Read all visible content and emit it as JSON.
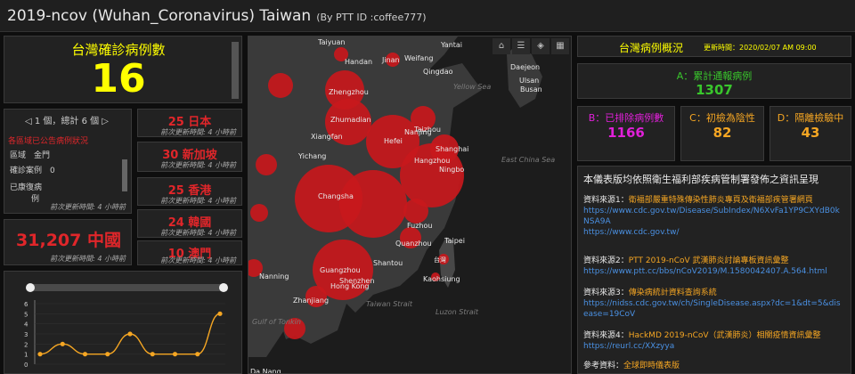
{
  "header": {
    "title": "2019-ncov (Wuhan_Coronavirus) Taiwan",
    "byline": "(By PTT ID :coffee777)"
  },
  "total": {
    "label": "台灣確診病例數",
    "value": "16"
  },
  "regions": {
    "pager": "1 個，總計 6 個",
    "heading": "各區域已公告病例狀況",
    "rows": [
      {
        "k": "區域",
        "v": "金門"
      },
      {
        "k": "確診案例",
        "v": "0"
      },
      {
        "k": "已康復病",
        "v": ""
      },
      {
        "k": "例",
        "v": ""
      }
    ],
    "updated": "前次更新時間: 4 小時前"
  },
  "china": {
    "value": "31,207 中國",
    "updated": "前次更新時間: 4 小時前"
  },
  "countries": [
    {
      "value": "25 日本",
      "updated": "前次更新時間: 4 小時前"
    },
    {
      "value": "30 新加坡",
      "updated": "前次更新時間: 4 小時前"
    },
    {
      "value": "25 香港",
      "updated": "前次更新時間: 4 小時前"
    },
    {
      "value": "24 韓國",
      "updated": "前次更新時間: 4 小時前"
    },
    {
      "value": "10 澳門",
      "updated": "前次更新時間: 4 小時前"
    }
  ],
  "chart_data": {
    "type": "line",
    "y_ticks": [
      "0",
      "1",
      "2",
      "3",
      "4",
      "5",
      "6"
    ],
    "ylim": [
      0,
      6
    ],
    "values": [
      1,
      2,
      1,
      1,
      3,
      1,
      1,
      1,
      5
    ],
    "color": "#f5a623"
  },
  "map": {
    "buttons": [
      "⌂",
      "☰",
      "◈",
      "▦"
    ],
    "cities": [
      "Taiyuan",
      "Yantai",
      "Handan",
      "Jinan",
      "Weifang",
      "Qingdao",
      "Daejeon",
      "Ulsan",
      "Busan",
      "Zhengzhou",
      "Zhumadian",
      "Taizhou",
      "Xiangfan",
      "Hefei",
      "Nanjing",
      "Shanghai",
      "Yichang",
      "Hangzhou",
      "Ningbo",
      "Changsha",
      "Fuzhou",
      "Quanzhou",
      "Taipei",
      "Shantou",
      "Guangzhou",
      "Shenzhen",
      "Hong Kong",
      "Kaohsiung",
      "Nanning",
      "Zhanjiang",
      "Da Nang"
    ],
    "waters": [
      "Yellow Sea",
      "East China Sea",
      "Taiwan Strait",
      "Luzon Strait",
      "Gulf of Tonkin"
    ],
    "tw_label": "台灣"
  },
  "overview": {
    "title": "台灣病例概況",
    "updated": "更新時間：2020/02/07 AM 09:00"
  },
  "stats": [
    {
      "label": "A：累計通報病例",
      "value": "1307",
      "color": "#39c62c"
    },
    {
      "label": "B：已排除病例數",
      "value": "1166",
      "color": "#e020d8"
    },
    {
      "label": "C：初檢為陰性",
      "value": "82",
      "color": "#f5a623"
    },
    {
      "label": "D：隔離檢驗中",
      "value": "43",
      "color": "#f5a623"
    }
  ],
  "info": {
    "heading": "本儀表版均依照衛生福利部疾病管制署發佈之資訊呈現",
    "sources": [
      {
        "key": "資料來源1：",
        "name": "衛福部嚴重特殊傳染性肺炎專頁及衛福部疾管署網頁",
        "urls": [
          "https://www.cdc.gov.tw/Disease/SubIndex/N6XvFa1YP9CXYdB0kNSA9A",
          "https://www.cdc.gov.tw/"
        ]
      },
      {
        "key": "資料來源2：",
        "name": "PTT 2019-nCoV 武漢肺炎討論專板資訊彙整",
        "urls": [
          "https://www.ptt.cc/bbs/nCoV2019/M.1580042407.A.564.html"
        ]
      },
      {
        "key": "資料來源3：",
        "name": "傳染病統計資料查詢系統",
        "urls": [
          "https://nidss.cdc.gov.tw/ch/SingleDisease.aspx?dc=1&dt=5&disease=19CoV"
        ]
      },
      {
        "key": "資料來源4：",
        "name": "HackMD 2019-nCoV（武漢肺炎）相關疫情資訊彙整",
        "urls": [
          "https://reurl.cc/XXzyya"
        ]
      },
      {
        "key": "參考資料：",
        "name": "全球即時儀表版",
        "urls": []
      }
    ]
  }
}
